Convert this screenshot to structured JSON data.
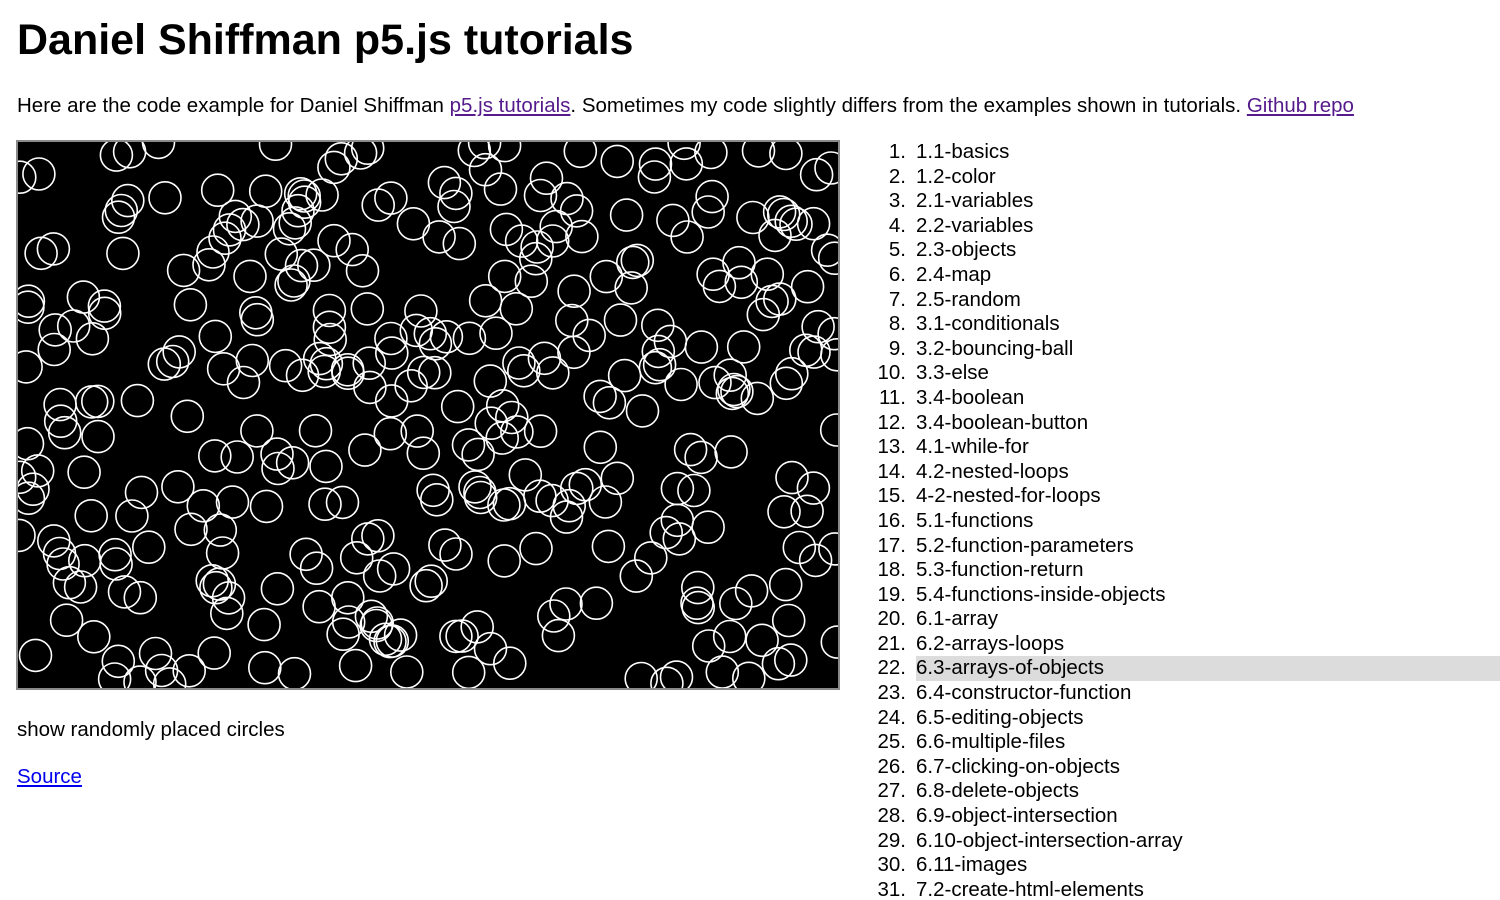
{
  "page": {
    "title": "Daniel Shiffman p5.js tutorials",
    "intro_before": "Here are the code example for Daniel Shiffman ",
    "intro_link": "p5.js tutorials",
    "intro_middle": ". Sometimes my code slightly differs from the examples shown in tutorials. ",
    "repo_link": "Github repo"
  },
  "sketch": {
    "background": "#000000",
    "stroke": "#ffffff",
    "description": "show randomly placed circles",
    "source_link": "Source"
  },
  "tutorials": {
    "active_index": 21,
    "highlight_color": "#dcdcdc",
    "items": [
      {
        "num": "1.",
        "label": "1.1-basics"
      },
      {
        "num": "2.",
        "label": "1.2-color"
      },
      {
        "num": "3.",
        "label": "2.1-variables"
      },
      {
        "num": "4.",
        "label": "2.2-variables"
      },
      {
        "num": "5.",
        "label": "2.3-objects"
      },
      {
        "num": "6.",
        "label": "2.4-map"
      },
      {
        "num": "7.",
        "label": "2.5-random"
      },
      {
        "num": "8.",
        "label": "3.1-conditionals"
      },
      {
        "num": "9.",
        "label": "3.2-bouncing-ball"
      },
      {
        "num": "10.",
        "label": "3.3-else"
      },
      {
        "num": "11.",
        "label": "3.4-boolean"
      },
      {
        "num": "12.",
        "label": "3.4-boolean-button"
      },
      {
        "num": "13.",
        "label": "4.1-while-for"
      },
      {
        "num": "14.",
        "label": "4.2-nested-loops"
      },
      {
        "num": "15.",
        "label": "4-2-nested-for-loops"
      },
      {
        "num": "16.",
        "label": "5.1-functions"
      },
      {
        "num": "17.",
        "label": "5.2-function-parameters"
      },
      {
        "num": "18.",
        "label": "5.3-function-return"
      },
      {
        "num": "19.",
        "label": "5.4-functions-inside-objects"
      },
      {
        "num": "20.",
        "label": "6.1-array"
      },
      {
        "num": "21.",
        "label": "6.2-arrays-loops"
      },
      {
        "num": "22.",
        "label": "6.3-arrays-of-objects"
      },
      {
        "num": "23.",
        "label": "6.4-constructor-function"
      },
      {
        "num": "24.",
        "label": "6.5-editing-objects"
      },
      {
        "num": "25.",
        "label": "6.6-multiple-files"
      },
      {
        "num": "26.",
        "label": "6.7-clicking-on-objects"
      },
      {
        "num": "27.",
        "label": "6.8-delete-objects"
      },
      {
        "num": "28.",
        "label": "6.9-object-intersection"
      },
      {
        "num": "29.",
        "label": "6.10-object-intersection-array"
      },
      {
        "num": "30.",
        "label": "6.11-images"
      },
      {
        "num": "31.",
        "label": "7.2-create-html-elements"
      }
    ]
  }
}
